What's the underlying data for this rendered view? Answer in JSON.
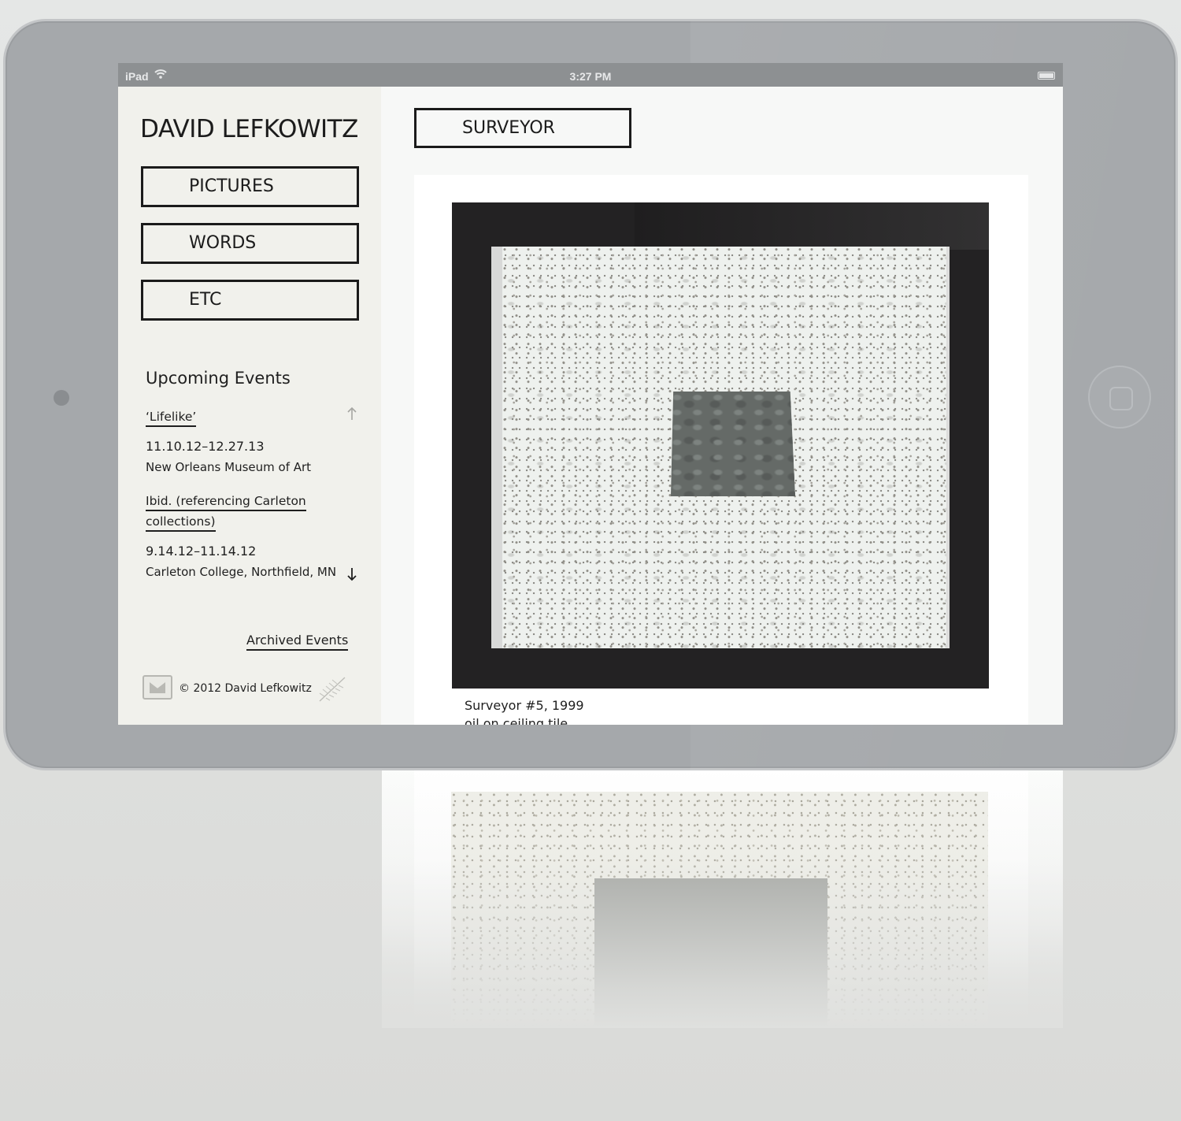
{
  "status_bar": {
    "carrier": "iPad",
    "time": "3:27 PM"
  },
  "sidebar": {
    "site_title": "DAVID LEFKOWITZ",
    "nav": [
      {
        "label": "PICTURES"
      },
      {
        "label": "WORDS"
      },
      {
        "label": "ETC"
      }
    ],
    "events_heading": "Upcoming Events",
    "events": [
      {
        "title": "‘Lifelike’",
        "dates": "11.10.12–12.27.13",
        "venue": "New Orleans Museum of Art"
      },
      {
        "title_line1": "Ibid. (referencing Carleton",
        "title_line2": "collections)",
        "dates": "9.14.12–11.14.12",
        "venue": "Carleton College, Northfield, MN"
      }
    ],
    "archived_link": "Archived Events",
    "copyright": "© 2012 David Lefkowitz"
  },
  "content": {
    "section_label": "SURVEYOR",
    "caption_title": "Surveyor #5, 1999",
    "caption_medium": "oil on ceiling tile"
  },
  "icons": {
    "wifi": "wifi-icon",
    "battery": "battery-icon",
    "scroll_up": "arrow-up-icon",
    "scroll_down": "arrow-down-icon",
    "mail": "mail-icon",
    "leaf": "wheat-leaf-icon"
  }
}
